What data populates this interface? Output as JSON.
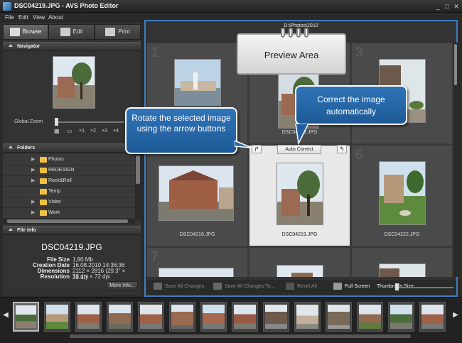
{
  "window": {
    "title": "DSC04219.JPG - AVS Photo Editor",
    "minimize": "_",
    "maximize": "□",
    "close": "✕"
  },
  "menu": [
    "File",
    "Edit",
    "View",
    "About"
  ],
  "tabs": [
    {
      "label": "Browse",
      "icon": "browse-icon",
      "active": true
    },
    {
      "label": "Edit",
      "icon": "edit-icon",
      "active": false
    },
    {
      "label": "Print",
      "icon": "print-icon",
      "active": false
    }
  ],
  "navigator": {
    "header": "Navigator",
    "zoom_label": "Global Zoom",
    "zoom_options": [
      "×1",
      "×2",
      "×3",
      "×4"
    ]
  },
  "folders": {
    "header": "Folders",
    "items": [
      {
        "label": "Photos",
        "expand": "▶",
        "selected": false
      },
      {
        "label": "REDESIGN",
        "expand": "▶",
        "selected": false
      },
      {
        "label": "Rock&Roll",
        "expand": "▶",
        "selected": false
      },
      {
        "label": "Temp",
        "expand": "",
        "selected": false
      },
      {
        "label": "Video",
        "expand": "▶",
        "selected": false
      },
      {
        "label": "Work",
        "expand": "▶",
        "selected": false
      }
    ]
  },
  "file_info": {
    "header": "File Info",
    "name": "DSC04219.JPG",
    "rows": [
      {
        "key": "File Size",
        "value": "1,90 Mb"
      },
      {
        "key": "Creation Date",
        "value": "16.08.2010 14:36:36"
      },
      {
        "key": "Dimensions",
        "value": "2112 × 2816 (29.3\" × 39.1\")"
      },
      {
        "key": "Resolution",
        "value": "72 dpi × 72 dpi"
      }
    ],
    "more_button": "More Info..."
  },
  "preview": {
    "path": "D:\\Photos\\2010",
    "area_label": "Preview Area",
    "auto_correct": "Auto Correct",
    "rotate_left": "↱",
    "rotate_right": "↰",
    "cells": [
      {
        "num": "1",
        "name": "",
        "selected": false
      },
      {
        "num": "",
        "name": "DSC04219.JPG",
        "selected": false
      },
      {
        "num": "3",
        "name": "",
        "selected": false
      },
      {
        "num": "",
        "name": "DSC04218.JPG",
        "selected": false
      },
      {
        "num": "",
        "name": "DSC04219.JPG",
        "selected": true
      },
      {
        "num": "6",
        "name": "DSC04222.JPG",
        "selected": false
      },
      {
        "num": "7",
        "name": "",
        "selected": false
      },
      {
        "num": "",
        "name": "",
        "selected": false
      },
      {
        "num": "",
        "name": "",
        "selected": false
      }
    ]
  },
  "callouts": {
    "rotate": "Rotate the selected image using the arrow buttons",
    "autocorrect": "Correct the image automatically"
  },
  "bottom_toolbar": {
    "save_all": "Save All Changes",
    "save_all_to": "Save All Changes To...",
    "reset_all": "Reset All",
    "full_screen": "Full Screen",
    "thumbnails_size": "Thumbnails Size:"
  },
  "filmstrip": {
    "left_arrow": "◀",
    "right_arrow": "▶",
    "count": 14
  }
}
